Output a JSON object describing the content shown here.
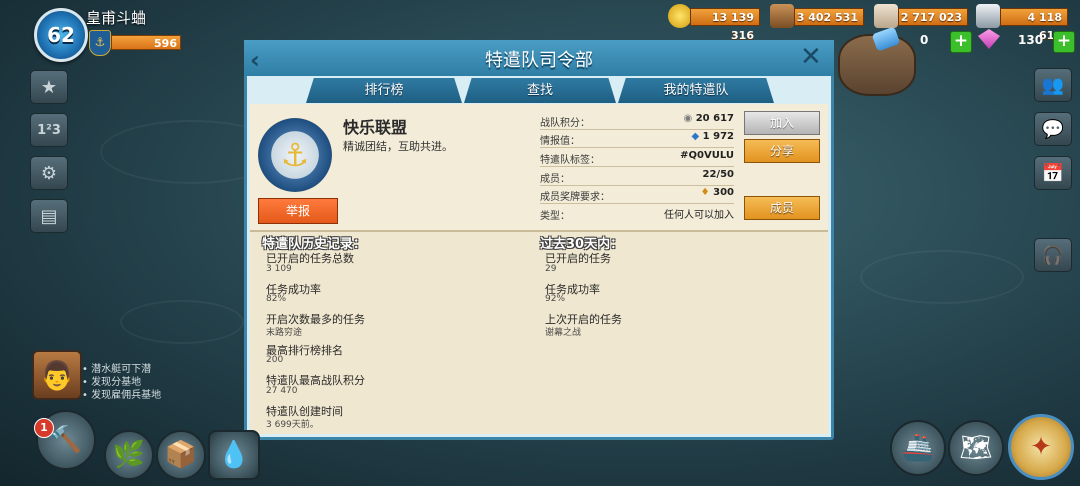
{
  "player": {
    "level": "62",
    "name": "皇甫斗蛐",
    "trophies": "596"
  },
  "resources": {
    "gold": "13 139 316",
    "wood": "3 402 531",
    "stone": "2 717 023",
    "iron": "4 118 614",
    "tickets": "0",
    "diamonds": "130"
  },
  "panel": {
    "title": "特遣队司令部",
    "tabs": [
      "排行榜",
      "查找",
      "我的特遣队"
    ],
    "clan": {
      "name": "快乐联盟",
      "description": "精诚团结，互助共进。"
    },
    "report_label": "举报",
    "stats": [
      {
        "label": "战队积分：",
        "value": "20 617"
      },
      {
        "label": "情报值：",
        "value": "1 972"
      },
      {
        "label": "特遣队标签：",
        "value": "#Q0VULU"
      },
      {
        "label": "成员：",
        "value": "22/50"
      },
      {
        "label": "成员奖牌要求：",
        "value": "300"
      },
      {
        "label": "类型：",
        "value": "任何人可以加入"
      }
    ],
    "buttons": {
      "join": "加入",
      "share": "分享",
      "members": "成员"
    },
    "history": {
      "title": "特遣队历史记录：",
      "items": [
        {
          "label": "已开启的任务总数",
          "value": "3 109"
        },
        {
          "label": "任务成功率",
          "value": "82%"
        },
        {
          "label": "开启次数最多的任务",
          "value": "末路穷途"
        },
        {
          "label": "最高排行榜排名",
          "value": "200"
        },
        {
          "label": "特遣队最高战队积分",
          "value": "27 470"
        },
        {
          "label": "特遣队创建时间",
          "value": "3 699天前。"
        }
      ]
    },
    "last30": {
      "title": "过去30天内：",
      "items": [
        {
          "label": "已开启的任务",
          "value": "29"
        },
        {
          "label": "任务成功率",
          "value": "92%"
        },
        {
          "label": "上次开启的任务",
          "value": "谢幕之战"
        }
      ]
    }
  },
  "quests": [
    "潜水艇可下潜",
    "发现分基地",
    "发现雇佣兵基地"
  ],
  "notifications": {
    "build_count": "1"
  }
}
